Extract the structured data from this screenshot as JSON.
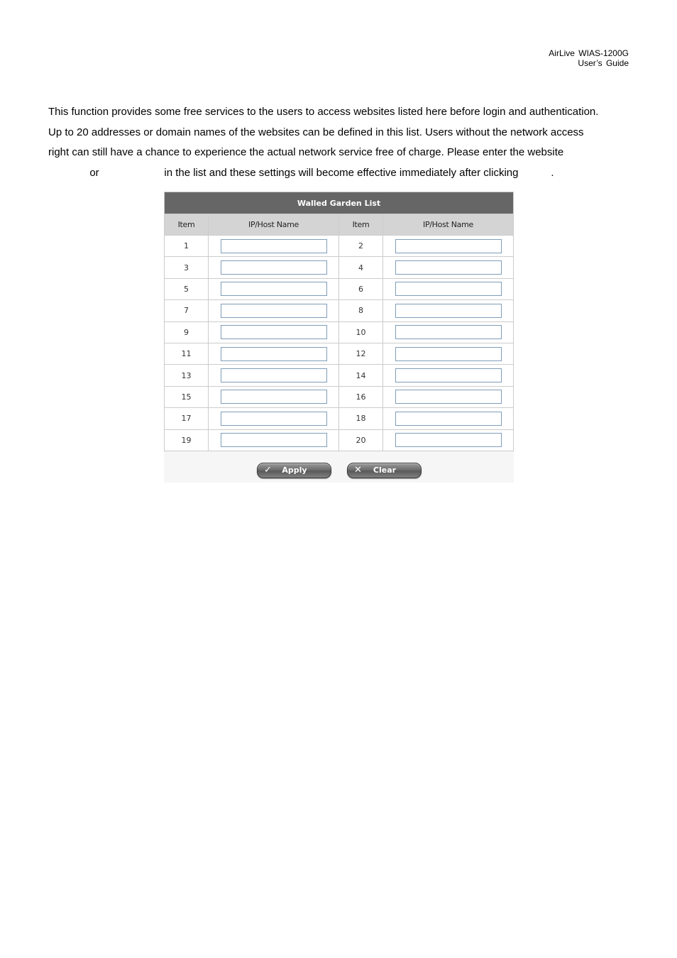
{
  "header": {
    "line1": "AirLive  WIAS-1200G",
    "line2": "User’s  Guide"
  },
  "paragraph": {
    "lines": [
      "This function provides some free services to the users to access websites listed here before login and authentication.",
      "Up to 20 addresses or domain names of the websites can be defined in this list. Users without the network access",
      "right can still have a chance to experience the actual network service free of charge. Please enter the website",
      "              or                      in the list and these settings will become effective immediately after clicking           ."
    ]
  },
  "walled_garden": {
    "title": "Walled Garden List",
    "columns": [
      "Item",
      "IP/Host Name",
      "Item",
      "IP/Host Name"
    ],
    "rows": [
      {
        "left_item": "1",
        "left_value": "",
        "right_item": "2",
        "right_value": ""
      },
      {
        "left_item": "3",
        "left_value": "",
        "right_item": "4",
        "right_value": ""
      },
      {
        "left_item": "5",
        "left_value": "",
        "right_item": "6",
        "right_value": ""
      },
      {
        "left_item": "7",
        "left_value": "",
        "right_item": "8",
        "right_value": ""
      },
      {
        "left_item": "9",
        "left_value": "",
        "right_item": "10",
        "right_value": ""
      },
      {
        "left_item": "11",
        "left_value": "",
        "right_item": "12",
        "right_value": ""
      },
      {
        "left_item": "13",
        "left_value": "",
        "right_item": "14",
        "right_value": ""
      },
      {
        "left_item": "15",
        "left_value": "",
        "right_item": "16",
        "right_value": ""
      },
      {
        "left_item": "17",
        "left_value": "",
        "right_item": "18",
        "right_value": ""
      },
      {
        "left_item": "19",
        "left_value": "",
        "right_item": "20",
        "right_value": ""
      }
    ],
    "buttons": {
      "apply": {
        "label": "Apply",
        "icon": "checkmark-icon",
        "glyph": "✓"
      },
      "clear": {
        "label": "Clear",
        "icon": "x-icon",
        "glyph": "✕"
      }
    }
  },
  "colors": {
    "title_bar": "#666666",
    "column_header": "#d4d4d4",
    "grid_border": "#cccccc",
    "input_border": "#7f9db9",
    "button_area": "#f6f6f6"
  }
}
